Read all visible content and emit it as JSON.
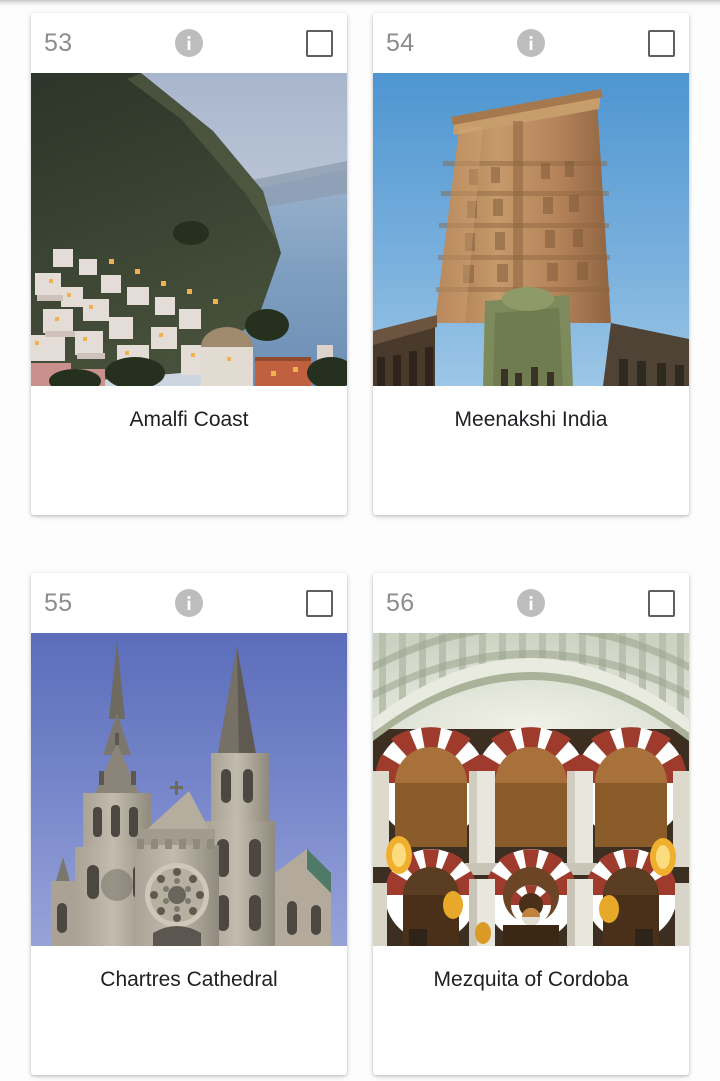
{
  "layout": {
    "columns": 2,
    "background_color": "#fdfdfd",
    "card_background": "#ffffff",
    "number_color": "#8c8c8c",
    "caption_color": "#202124",
    "info_icon_color": "#bdbdbd",
    "checkbox_border_color": "#5f5f5f"
  },
  "cards": [
    {
      "number": "53",
      "caption": "Amalfi Coast",
      "info_icon": "info-icon",
      "checkbox_checked": false,
      "image": {
        "alt": "Amalfi Coast",
        "sky_color": "#b9c3d6",
        "sea_color": "#7e9ec0",
        "hillside_color": "#33402f",
        "building_color": "#e4dcd6",
        "light_color": "#f2b14e"
      }
    },
    {
      "number": "54",
      "caption": "Meenakshi India",
      "info_icon": "info-icon",
      "checkbox_checked": false,
      "image": {
        "alt": "Meenakshi India",
        "sky_color": "#6aa7d8",
        "tower_color": "#b98a5c",
        "tower_shadow_color": "#8d6540",
        "base_color": "#7d8a5c",
        "roof_color": "#4a3a2c"
      }
    },
    {
      "number": "55",
      "caption": "Chartres Cathedral",
      "info_icon": "info-icon",
      "checkbox_checked": false,
      "image": {
        "alt": "Chartres Cathedral",
        "sky_color": "#6f7fc4",
        "stone_color": "#b9b3a6",
        "stone_shadow_color": "#8f8a7d",
        "spire_color": "#6f6a60",
        "roof_color": "#4f7a68"
      }
    },
    {
      "number": "56",
      "caption": "Mezquita of Cordoba",
      "info_icon": "info-icon",
      "checkbox_checked": false,
      "image": {
        "alt": "Mezquita of Cordoba",
        "vault_color": "#dfe2d5",
        "stone_color": "#e8e6dd",
        "stripe_red_color": "#9e3b2c",
        "arch_interior_color": "#9c6a32",
        "lamp_color": "#f0b02e",
        "dark_color": "#4a3524"
      }
    }
  ]
}
